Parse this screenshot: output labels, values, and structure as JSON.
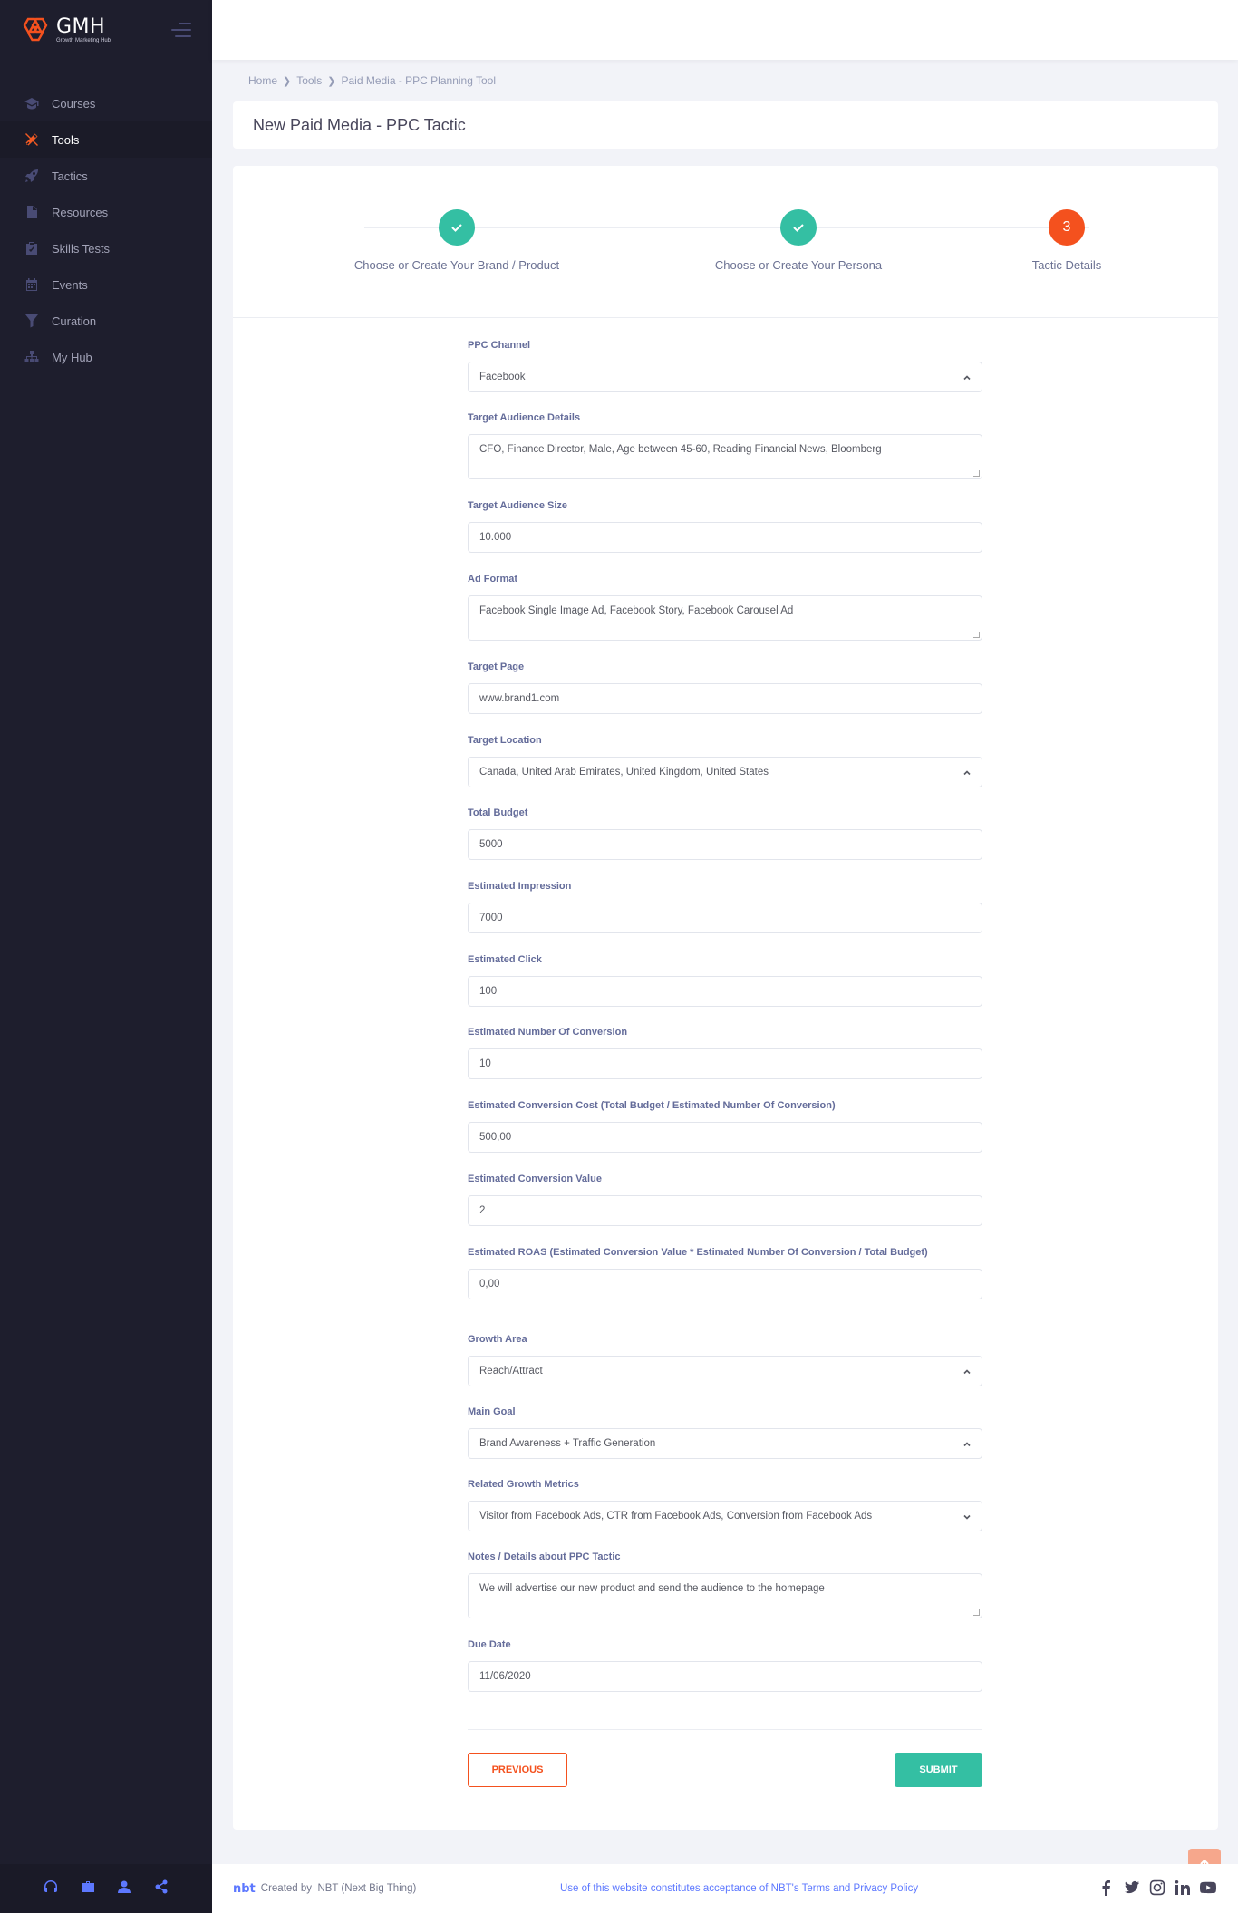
{
  "brand": {
    "title": "GMH",
    "subtitle": "Growth Marketing Hub"
  },
  "sidebar": {
    "items": [
      {
        "label": "Courses",
        "icon": "graduation-cap-icon"
      },
      {
        "label": "Tools",
        "icon": "tools-icon"
      },
      {
        "label": "Tactics",
        "icon": "rocket-icon"
      },
      {
        "label": "Resources",
        "icon": "file-icon"
      },
      {
        "label": "Skills Tests",
        "icon": "clipboard-check-icon"
      },
      {
        "label": "Events",
        "icon": "calendar-icon"
      },
      {
        "label": "Curation",
        "icon": "filter-icon"
      },
      {
        "label": "My Hub",
        "icon": "sitemap-icon"
      }
    ],
    "footer_icons": [
      "headset-icon",
      "briefcase-icon",
      "user-icon",
      "share-icon"
    ]
  },
  "breadcrumb": {
    "home": "Home",
    "tools": "Tools",
    "current": "Paid Media - PPC Planning Tool"
  },
  "page_title": "New Paid Media - PPC Tactic",
  "wizard": {
    "steps": [
      {
        "label": "Choose or Create Your Brand / Product",
        "state": "done"
      },
      {
        "label": "Choose or Create Your Persona",
        "state": "done"
      },
      {
        "label": "Tactic Details",
        "state": "current",
        "number": "3"
      }
    ]
  },
  "form": {
    "ppc_channel": {
      "label": "PPC Channel",
      "value": "Facebook"
    },
    "target_audience_details": {
      "label": "Target Audience Details",
      "value": "CFO, Finance Director, Male, Age between 45-60, Reading Financial News, Bloomberg"
    },
    "target_audience_size": {
      "label": "Target Audience Size",
      "value": "10.000"
    },
    "ad_format": {
      "label": "Ad Format",
      "value": "Facebook Single Image Ad, Facebook Story, Facebook Carousel Ad"
    },
    "target_page": {
      "label": "Target Page",
      "value": "www.brand1.com"
    },
    "target_location": {
      "label": "Target Location",
      "value": "Canada, United Arab Emirates, United Kingdom, United States"
    },
    "total_budget": {
      "label": "Total Budget",
      "value": "5000"
    },
    "estimated_impression": {
      "label": "Estimated Impression",
      "value": "7000"
    },
    "estimated_click": {
      "label": "Estimated Click",
      "value": "100"
    },
    "estimated_conversions": {
      "label": "Estimated Number Of Conversion",
      "value": "10"
    },
    "estimated_conversion_cost": {
      "label": "Estimated Conversion Cost (Total Budget / Estimated Number Of Conversion)",
      "value": "500,00"
    },
    "estimated_conversion_value": {
      "label": "Estimated Conversion Value",
      "value": "2"
    },
    "estimated_roas": {
      "label": "Estimated ROAS (Estimated Conversion Value * Estimated Number Of Conversion / Total Budget)",
      "value": "0,00"
    },
    "growth_area": {
      "label": "Growth Area",
      "value": "Reach/Attract"
    },
    "main_goal": {
      "label": "Main Goal",
      "value": "Brand Awareness + Traffic Generation"
    },
    "related_growth_metrics": {
      "label": "Related Growth Metrics",
      "value": "Visitor from Facebook Ads, CTR from Facebook Ads, Conversion from Facebook Ads"
    },
    "notes": {
      "label": "Notes / Details about PPC Tactic",
      "value": "We will advertise our new product and send the audience to the homepage"
    },
    "due_date": {
      "label": "Due Date",
      "value": "11/06/2020"
    }
  },
  "buttons": {
    "previous": "PREVIOUS",
    "submit": "SUBMIT"
  },
  "footer": {
    "logo": "nbt",
    "created_by": "Created by",
    "company": "NBT (Next Big Thing)",
    "notice": "Use of this website constitutes acceptance of NBT's",
    "terms": "Terms",
    "and": "and",
    "privacy": "Privacy Policy",
    "social": [
      "facebook-icon",
      "twitter-icon",
      "instagram-icon",
      "linkedin-icon",
      "youtube-icon"
    ]
  },
  "colors": {
    "accent": "#f4511e",
    "success": "#34bfa3",
    "sidebar": "#1e1e2d",
    "link": "#5d78ff"
  }
}
